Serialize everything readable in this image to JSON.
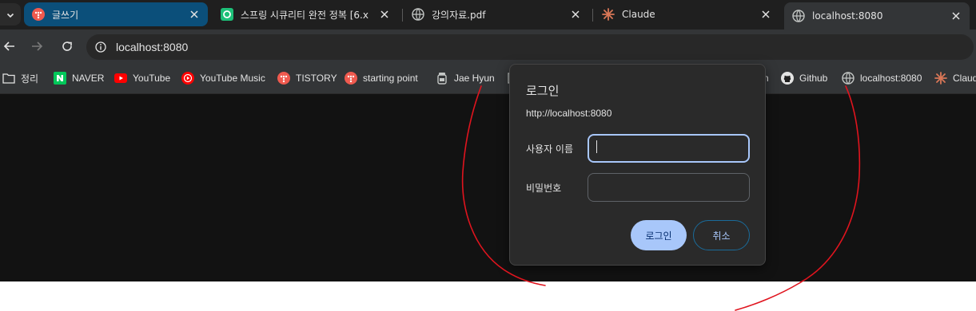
{
  "tabs": [
    {
      "title": "글쓰기"
    },
    {
      "title": "스프링 시큐리티 완전 정복 [6.x"
    },
    {
      "title": "강의자료.pdf"
    },
    {
      "title": "Claude"
    },
    {
      "title": "localhost:8080"
    }
  ],
  "address_bar": {
    "url": "localhost:8080"
  },
  "bookmarks": [
    {
      "label": "정리"
    },
    {
      "label": "NAVER"
    },
    {
      "label": "YouTube"
    },
    {
      "label": "YouTube Music"
    },
    {
      "label": "TISTORY"
    },
    {
      "label": "starting point"
    },
    {
      "label": "Jae Hyun"
    },
    {
      "label": "n"
    },
    {
      "label": "Github"
    },
    {
      "label": "localhost:8080"
    },
    {
      "label": "Claud"
    }
  ],
  "dialog": {
    "title": "로그인",
    "origin": "http://localhost:8080",
    "username_label": "사용자 이름",
    "username_value": "",
    "password_label": "비밀번호",
    "password_value": "",
    "login_button": "로그인",
    "cancel_button": "취소"
  },
  "colors": {
    "tab_strip": "#1f1f1f",
    "toolbar": "#333537",
    "active_tab_blue": "#0b4f7a",
    "dialog_bg": "#2a2a2a",
    "primary_button": "#a8c7fa",
    "annotation_stroke": "#e0141e"
  }
}
